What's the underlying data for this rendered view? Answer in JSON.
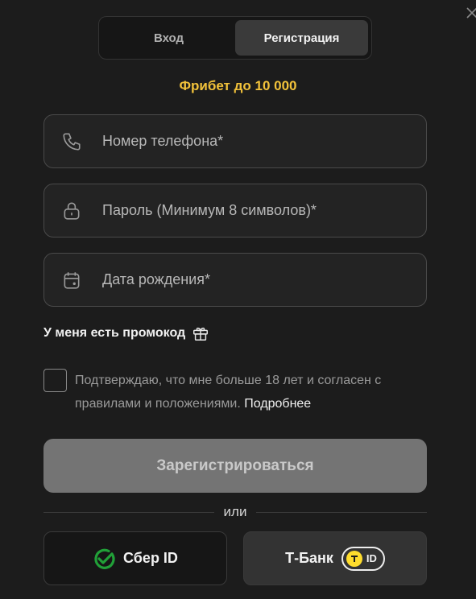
{
  "tabs": [
    {
      "label": "Вход",
      "active": false
    },
    {
      "label": "Регистрация",
      "active": true
    }
  ],
  "promo_text": "Фрибет до 10 000",
  "fields": {
    "phone": {
      "placeholder": "Номер телефона*",
      "icon": "phone-icon"
    },
    "password": {
      "placeholder": "Пароль (Минимум 8 символов)*",
      "icon": "lock-icon"
    },
    "birthdate": {
      "placeholder": "Дата рождения*",
      "icon": "calendar-icon"
    }
  },
  "promocode_label": "У меня есть промокод",
  "agreement": {
    "text": "Подтверждаю, что мне больше 18 лет и согласен с правилами и положениями.",
    "link": "Подробнее"
  },
  "submit_label": "Зарегистрироваться",
  "divider_label": "или",
  "sber_label": "Сбер ID",
  "tbank_label": "Т-Банк",
  "tbank_id_label": "ID",
  "colors": {
    "accent": "#f2c23a",
    "sber_green": "#21a038",
    "tbank_yellow": "#ffdd2d"
  }
}
